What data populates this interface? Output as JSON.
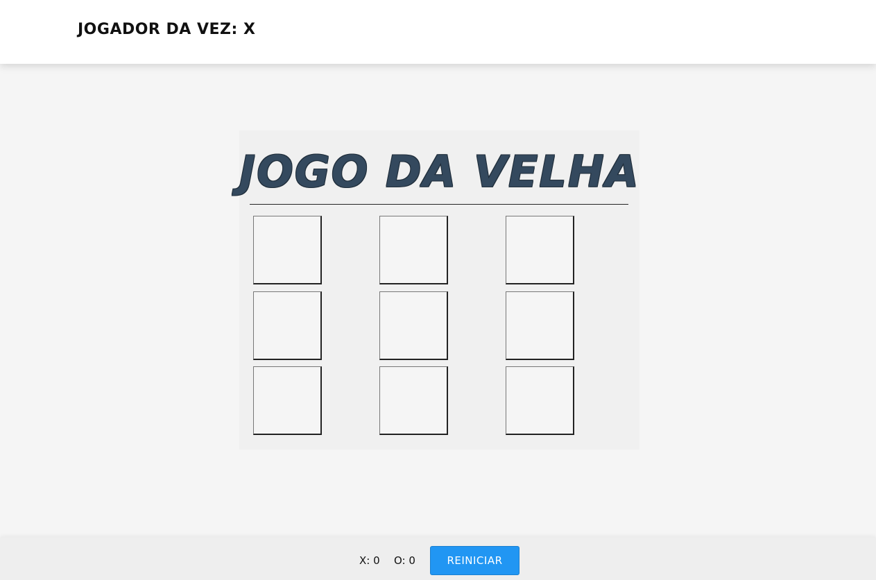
{
  "header": {
    "turn_label": "JOGADOR DA VEZ:",
    "current_player": "X"
  },
  "game": {
    "title": "JOGO DA VELHA",
    "board": [
      "",
      "",
      "",
      "",
      "",
      "",
      "",
      "",
      ""
    ]
  },
  "footer": {
    "score_x_label": "X:",
    "score_x": "0",
    "score_o_label": "O:",
    "score_o": "0",
    "restart_label": "REINICIAR"
  },
  "colors": {
    "title": "#34495e",
    "restart_button": "#2196f3",
    "background": "#f5f5f5"
  }
}
